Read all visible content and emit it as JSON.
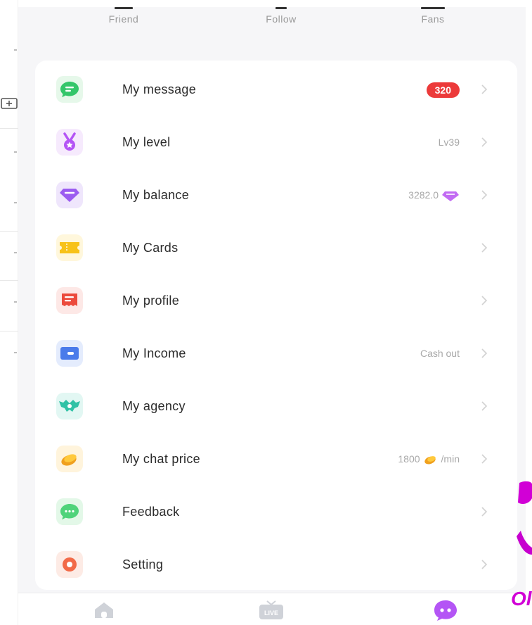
{
  "stats": [
    {
      "label": "Friend"
    },
    {
      "label": "Follow"
    },
    {
      "label": "Fans"
    }
  ],
  "menu": [
    {
      "label": "My message",
      "icon": "chat-bubble-icon",
      "badge": "320",
      "value": ""
    },
    {
      "label": "My level",
      "icon": "medal-icon",
      "badge": "",
      "value": "Lv39"
    },
    {
      "label": "My balance",
      "icon": "diamond-icon",
      "badge": "",
      "value": "3282.0"
    },
    {
      "label": "My Cards",
      "icon": "ticket-icon",
      "badge": "",
      "value": ""
    },
    {
      "label": "My profile",
      "icon": "profile-card-icon",
      "badge": "",
      "value": ""
    },
    {
      "label": "My Income",
      "icon": "wallet-icon",
      "badge": "",
      "value": "Cash out"
    },
    {
      "label": "My agency",
      "icon": "agency-shield-icon",
      "badge": "",
      "value": ""
    },
    {
      "label": "My chat price",
      "icon": "coin-icon",
      "badge": "",
      "value": "1800",
      "suffix": "/min"
    },
    {
      "label": "Feedback",
      "icon": "feedback-bubble-icon",
      "badge": "",
      "value": ""
    },
    {
      "label": "Setting",
      "icon": "settings-ring-icon",
      "badge": "",
      "value": ""
    }
  ],
  "tabbar": {
    "live_label": "LIVE"
  },
  "brand_text": "Ol",
  "colors": {
    "badge": "#ec3a3a",
    "accent_purple": "#b455f5",
    "brand_magenta": "#d100d6",
    "page_bg": "#f6f6f8"
  }
}
